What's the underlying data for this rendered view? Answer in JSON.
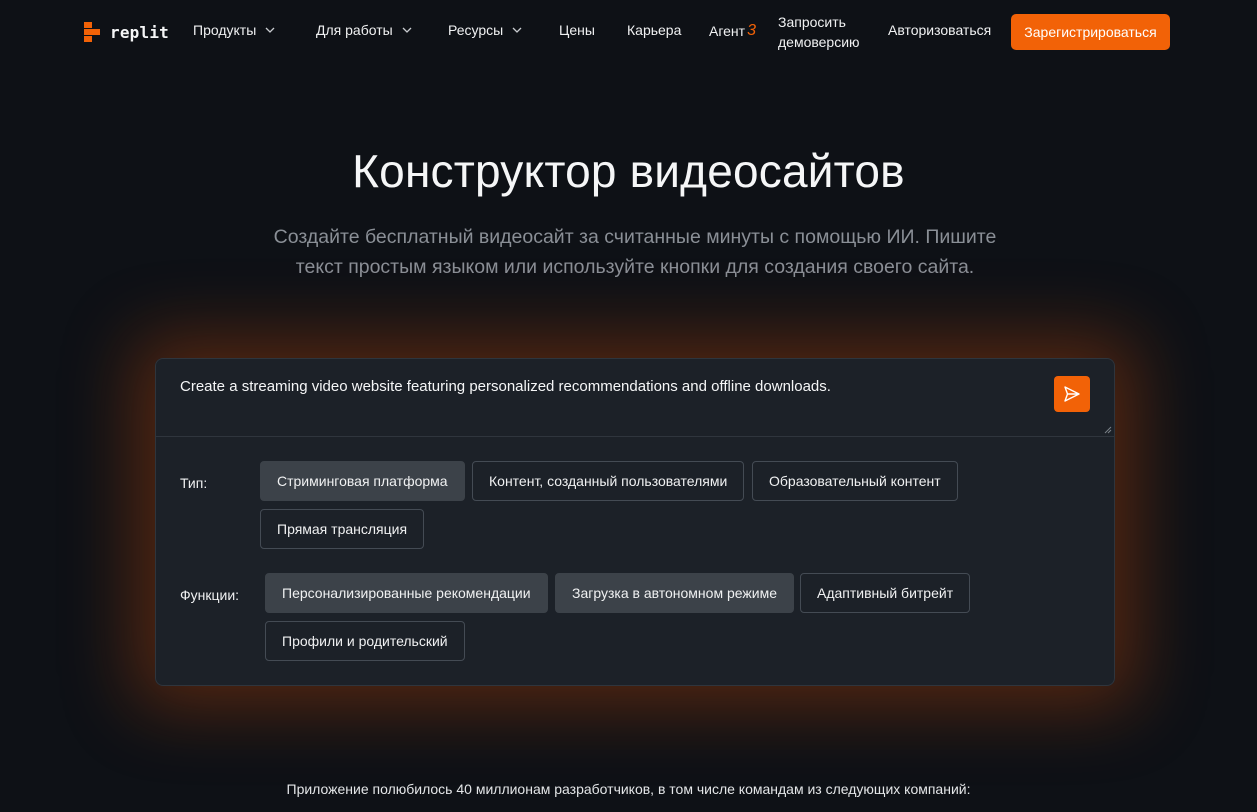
{
  "brand": {
    "name": "replit",
    "accent": "#f26207"
  },
  "nav": {
    "products": "Продукты",
    "for_work": "Для работы",
    "resources": "Ресурсы",
    "pricing": "Цены",
    "careers": "Карьера",
    "agent": "Агент",
    "agent_version": "3",
    "demo_line1": "Запросить",
    "demo_line2": "демоверсию",
    "login": "Авторизоваться",
    "signup": "Зарегистрироваться"
  },
  "hero": {
    "title": "Конструктор видеосайтов",
    "subtitle": "Создайте бесплатный видеосайт за считанные минуты с помощью ИИ. Пишите текст простым языком или используйте кнопки для создания своего сайта."
  },
  "prompt": {
    "value": "Create a streaming video website featuring personalized recommendations and offline downloads."
  },
  "filters": {
    "type": {
      "label": "Тип:",
      "options": [
        {
          "label": "Стриминговая платформа",
          "selected": true
        },
        {
          "label": "Контент, созданный пользователями",
          "selected": false
        },
        {
          "label": "Образовательный контент",
          "selected": false
        },
        {
          "label": "Прямая трансляция",
          "selected": false
        }
      ]
    },
    "features": {
      "label": "Функции:",
      "options": [
        {
          "label": "Персонализированные рекомендации",
          "selected": true
        },
        {
          "label": "Загрузка в автономном режиме",
          "selected": true
        },
        {
          "label": "Адаптивный битрейт",
          "selected": false
        },
        {
          "label": "Профили и родительский",
          "selected": false
        }
      ]
    }
  },
  "companies_text": "Приложение полюбилось 40 миллионам разработчиков, в том числе командам из следующих компаний:"
}
